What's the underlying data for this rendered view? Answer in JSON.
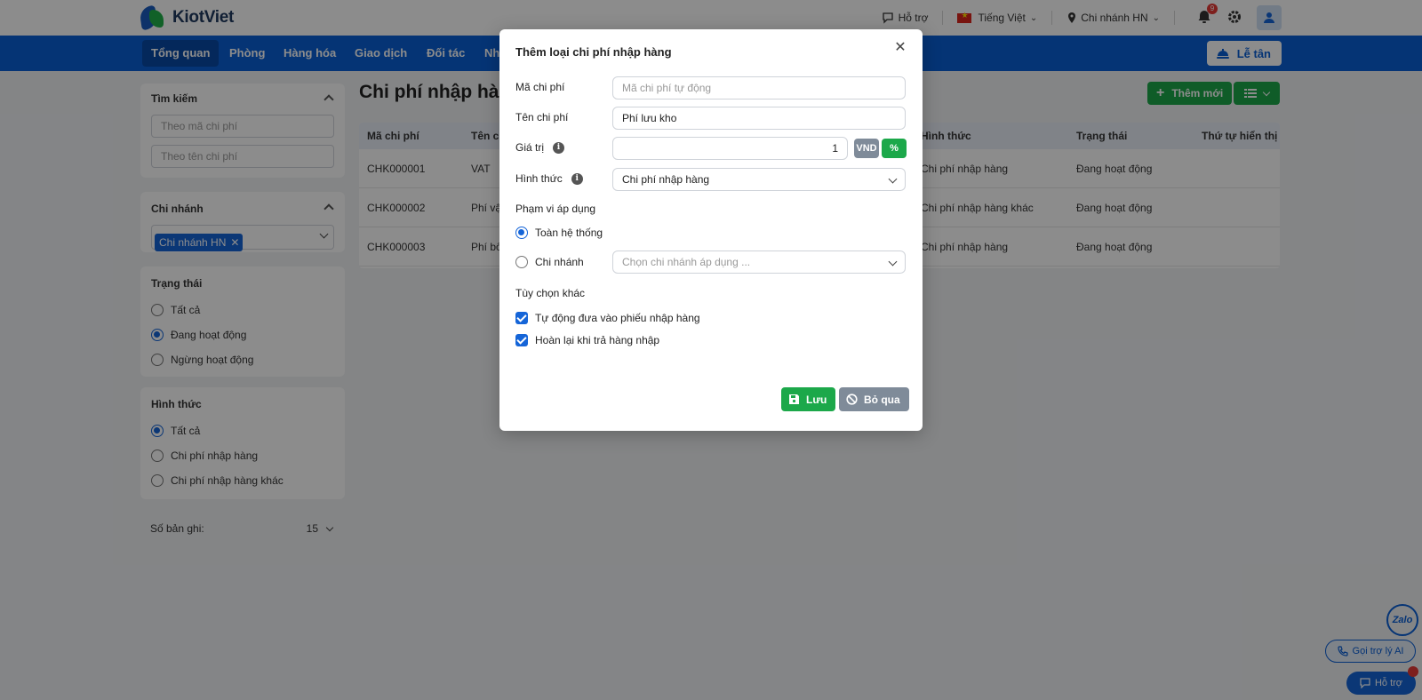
{
  "header": {
    "logo_text": "KiotViet",
    "support_label": "Hỗ trợ",
    "language_label": "Tiếng Việt",
    "branch_label": "Chi nhánh HN",
    "notification_count": "9"
  },
  "nav": {
    "items": [
      "Tổng quan",
      "Phòng",
      "Hàng hóa",
      "Giao dịch",
      "Đối tác",
      "Nh"
    ],
    "right_button": "Lễ tân"
  },
  "sidebar": {
    "search": {
      "title": "Tìm kiếm",
      "code_placeholder": "Theo mã chi phí",
      "name_placeholder": "Theo tên chi phí"
    },
    "branch": {
      "title": "Chi nhánh",
      "tag": "Chi nhánh HN"
    },
    "status": {
      "title": "Trạng thái",
      "options": [
        "Tất cả",
        "Đang hoạt động",
        "Ngừng hoạt động"
      ],
      "selected": "Đang hoạt động"
    },
    "form": {
      "title": "Hình thức",
      "options": [
        "Tất cả",
        "Chi phí nhập hàng",
        "Chi phí nhập hàng khác"
      ],
      "selected": "Tất cả"
    },
    "records": {
      "label": "Số bản ghi:",
      "value": "15"
    }
  },
  "main": {
    "title": "Chi phí nhập hà",
    "add_button": "Thêm mới",
    "columns": [
      "Mã chi phí",
      "Tên ch",
      "Hình thức",
      "Trạng thái",
      "Thứ tự hiển thị"
    ],
    "rows": [
      {
        "code": "CHK000001",
        "name": "VAT",
        "form": "Chi phí nhập hàng",
        "status": "Đang hoạt động"
      },
      {
        "code": "CHK000002",
        "name": "Phí vậ",
        "form": "Chi phí nhập hàng khác",
        "status": "Đang hoạt động"
      },
      {
        "code": "CHK000003",
        "name": "Phí bố",
        "form": "Chi phí nhập hàng",
        "status": "Đang hoạt động"
      }
    ]
  },
  "modal": {
    "title": "Thêm loại chi phí nhập hàng",
    "code_label": "Mã chi phí",
    "code_placeholder": "Mã chi phí tự động",
    "name_label": "Tên chi phí",
    "name_value": "Phí lưu kho",
    "value_label": "Giá trị",
    "value_value": "1",
    "vnd_label": "VND",
    "pct_label": "%",
    "form_label": "Hình thức",
    "form_value": "Chi phí nhập hàng",
    "scope_title": "Phạm vi áp dụng",
    "scope_all": "Toàn hệ thống",
    "scope_branch": "Chi nhánh",
    "scope_branch_placeholder": "Chọn chi nhánh áp dụng ...",
    "other_title": "Tùy chọn khác",
    "opt_auto": "Tự động đưa vào phiếu nhập hàng",
    "opt_refund": "Hoàn lại khi trả hàng nhập",
    "save_label": "Lưu",
    "skip_label": "Bỏ qua"
  },
  "widgets": {
    "zalo": "Zalo",
    "ai_label": "Gọi trợ lý AI",
    "help_label": "Hỗ trợ"
  },
  "colors": {
    "primary": "#0a5fd6",
    "success": "#1ca84a",
    "muted_button": "#7f8b99",
    "danger": "#e53935"
  }
}
